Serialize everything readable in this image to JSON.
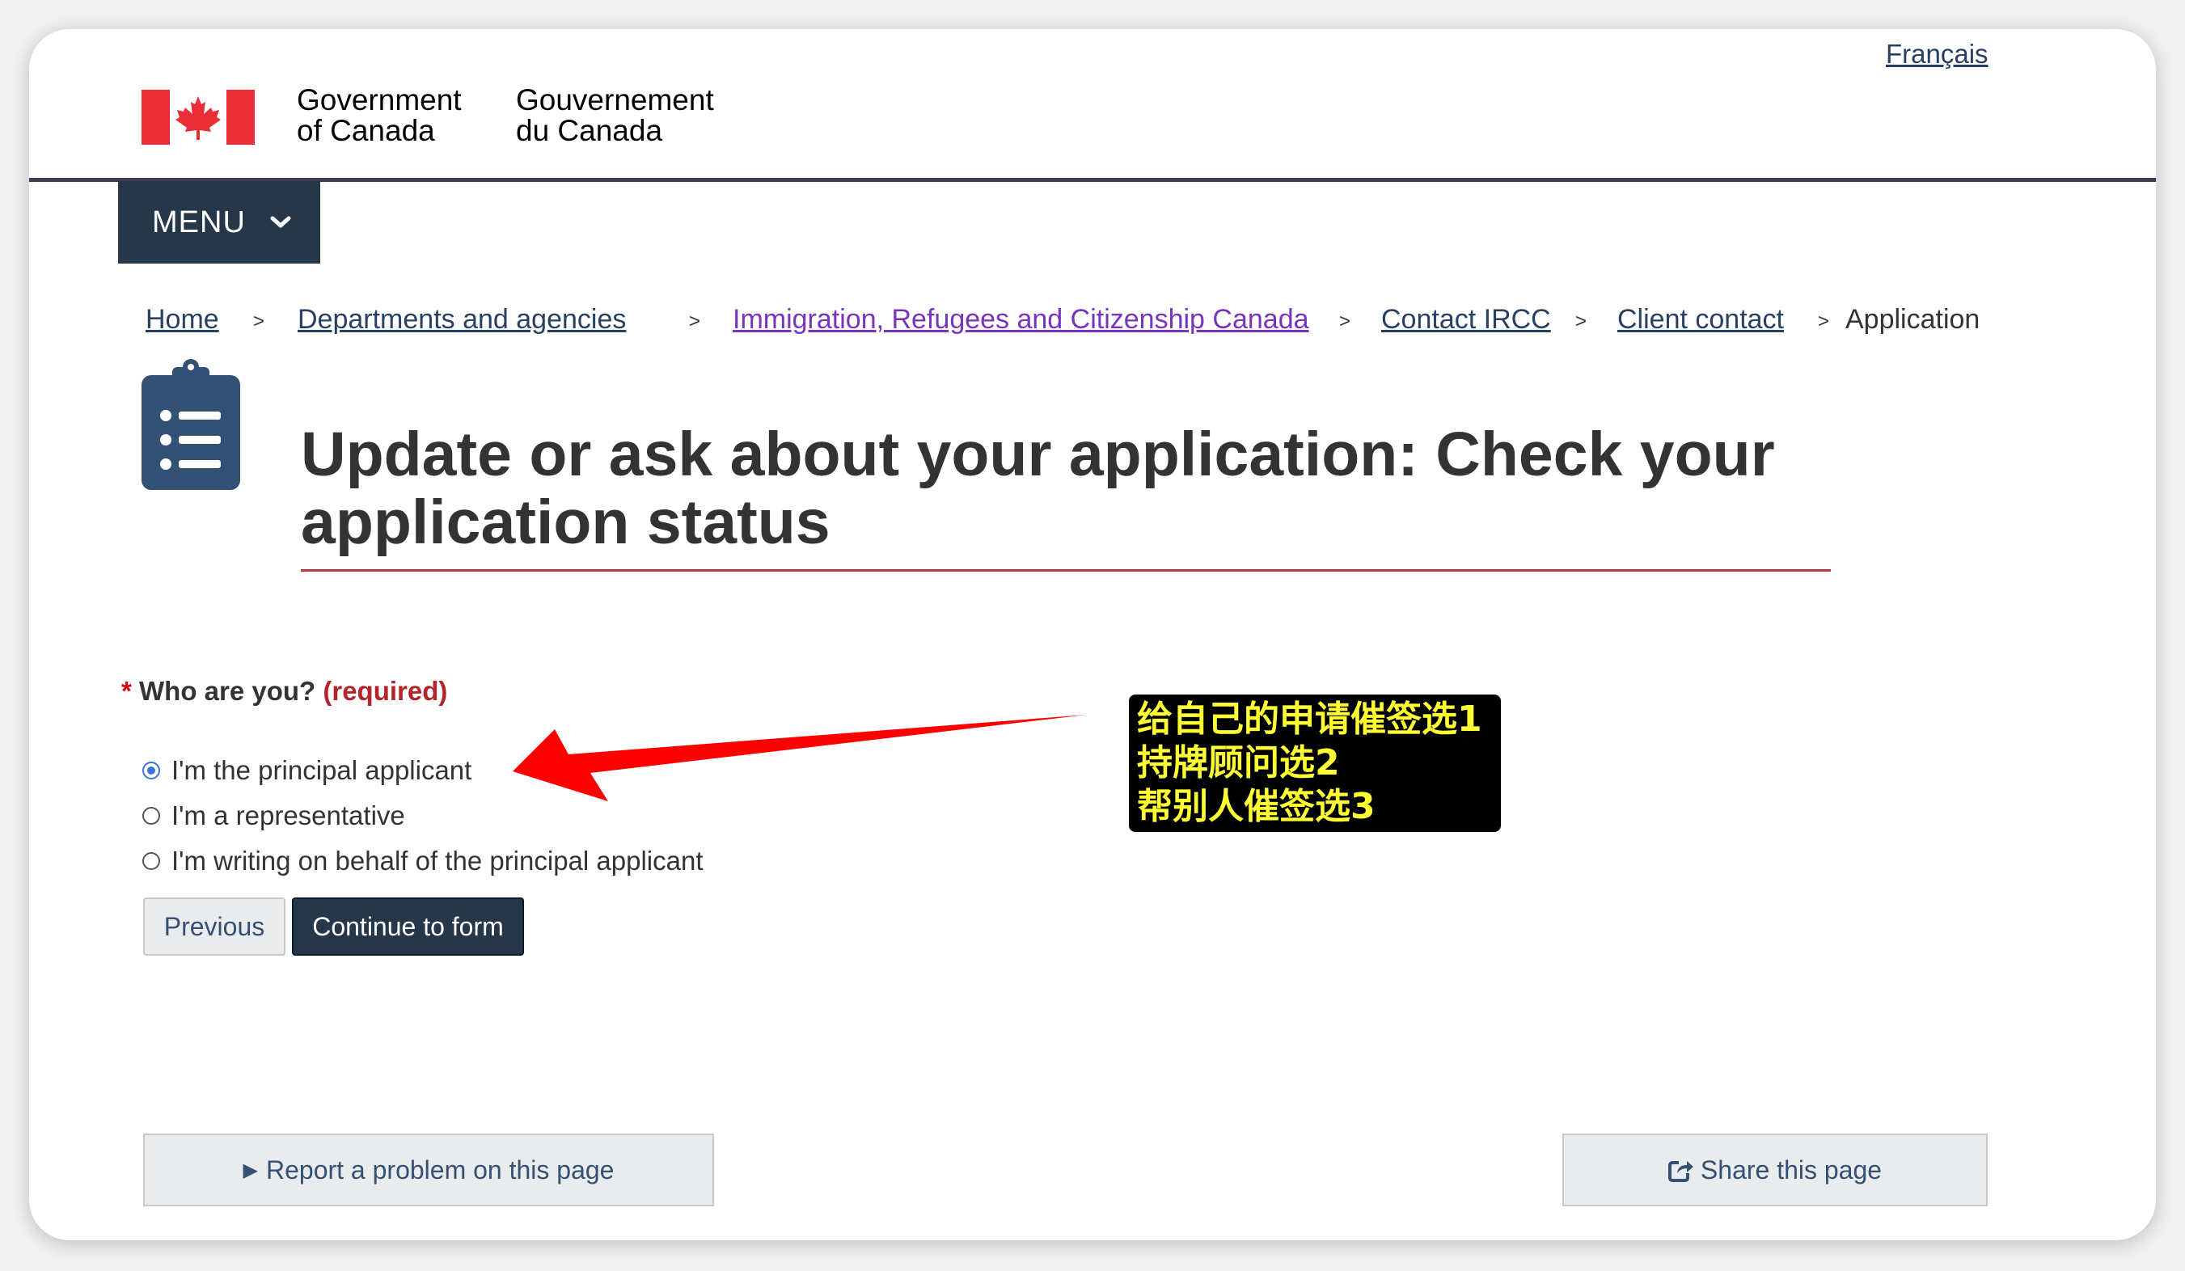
{
  "header": {
    "language_link": "Français",
    "signature_en_line1": "Government",
    "signature_en_line2": "of Canada",
    "signature_fr_line1": "Gouvernement",
    "signature_fr_line2": "du Canada",
    "flag_icon": "canada-flag-icon"
  },
  "menu": {
    "label": "MENU",
    "icon": "chevron-down-icon"
  },
  "breadcrumb": {
    "items": [
      {
        "label": "Home"
      },
      {
        "label": "Departments and agencies"
      },
      {
        "label": "Immigration, Refugees and Citizenship Canada"
      },
      {
        "label": "Contact IRCC"
      },
      {
        "label": "Client contact"
      },
      {
        "label": "Application"
      }
    ],
    "separator": ">"
  },
  "page": {
    "icon": "clipboard-list-icon",
    "title_line1": "Update or ask about your application: Check your",
    "title_line2": "application status"
  },
  "form": {
    "required_marker": "*",
    "question": "Who are you?",
    "required_label": "(required)",
    "options": [
      {
        "label": "I'm the principal applicant",
        "selected": true
      },
      {
        "label": "I'm a representative",
        "selected": false
      },
      {
        "label": "I'm writing on behalf of the principal applicant",
        "selected": false
      }
    ],
    "previous_label": "Previous",
    "continue_label": "Continue to form"
  },
  "annotation": {
    "lines": [
      "给自己的申请催签选1",
      "持牌顾问选2",
      "帮别人催签选3"
    ],
    "text_color": "#ffff33",
    "background": "#000000",
    "arrow_color": "#ff0000"
  },
  "footer": {
    "report_label": "Report a problem on this page",
    "report_icon": "triangle-right-icon",
    "share_label": "Share this page",
    "share_icon": "share-icon"
  },
  "colors": {
    "gc_dark_blue": "#26374a",
    "link": "#284162",
    "visited_link": "#7834bc",
    "title_rule": "#af3c43",
    "required": "#d3080c"
  }
}
